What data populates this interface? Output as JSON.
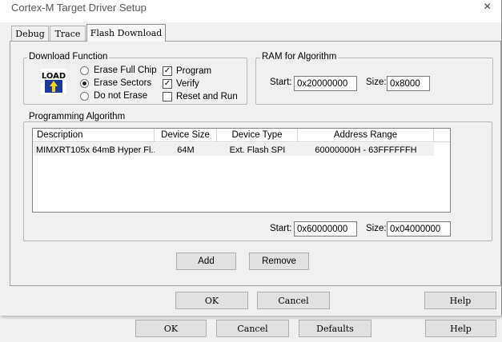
{
  "background": {
    "buttons": {
      "ok": "OK",
      "cancel": "Cancel",
      "defaults": "Defaults",
      "help": "Help"
    }
  },
  "dialog": {
    "title": "Cortex-M Target Driver Setup",
    "close": "×",
    "tabs": [
      {
        "label": "Debug",
        "active": false
      },
      {
        "label": "Trace",
        "active": false
      },
      {
        "label": "Flash Download",
        "active": true
      }
    ],
    "download_function": {
      "title": "Download Function",
      "icon_text": "LOAD",
      "radios": [
        {
          "label": "Erase Full Chip",
          "selected": false
        },
        {
          "label": "Erase Sectors",
          "selected": true
        },
        {
          "label": "Do not Erase",
          "selected": false
        }
      ],
      "checks": [
        {
          "label": "Program",
          "checked": true
        },
        {
          "label": "Verify",
          "checked": true
        },
        {
          "label": "Reset and Run",
          "checked": false
        }
      ]
    },
    "ram": {
      "title": "RAM for Algorithm",
      "start_label": "Start:",
      "start": "0x20000000",
      "size_label": "Size:",
      "size": "0x8000"
    },
    "programming": {
      "title": "Programming Algorithm",
      "columns": [
        "Description",
        "Device Size",
        "Device Type",
        "Address Range"
      ],
      "rows": [
        {
          "description": "MIMXRT105x 64mB Hyper Fl...",
          "size": "64M",
          "type": "Ext. Flash SPI",
          "range": "60000000H - 63FFFFFFH"
        }
      ],
      "start_label": "Start:",
      "start": "0x60000000",
      "size_label": "Size:",
      "size": "0x04000000",
      "add": "Add",
      "remove": "Remove"
    },
    "buttons": {
      "ok": "OK",
      "cancel": "Cancel",
      "help": "Help"
    }
  }
}
